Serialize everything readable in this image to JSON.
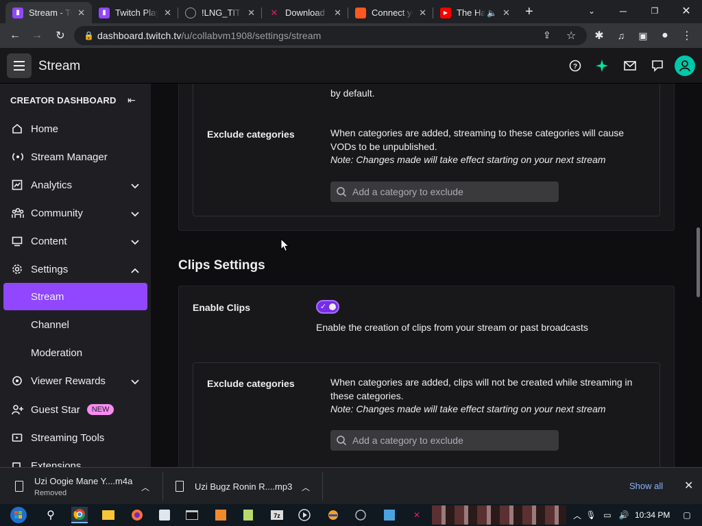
{
  "browser": {
    "tabs": [
      {
        "title": "Stream - Twitch",
        "active": true,
        "favicon": "twitch-icon",
        "color": "#9147ff"
      },
      {
        "title": "Twitch Plays",
        "active": false,
        "favicon": "twitch-icon",
        "color": "#9147ff"
      },
      {
        "title": "!LNG_TITLE",
        "active": false,
        "favicon": "globe-icon",
        "color": "#9aa0a6"
      },
      {
        "title": "Download",
        "active": false,
        "favicon": "download-site-icon",
        "color": "#e91e63"
      },
      {
        "title": "Connect yo",
        "active": false,
        "favicon": "orange-square-icon",
        "color": "#ff5722"
      },
      {
        "title": "The Ha",
        "active": false,
        "favicon": "youtube-icon",
        "color": "#ff0000"
      }
    ],
    "url_host": "dashboard.twitch.tv",
    "url_path": "/u/collabvm1908/settings/stream"
  },
  "topnav": {
    "title": "Stream"
  },
  "sidebar": {
    "header": "CREATOR DASHBOARD",
    "items": [
      {
        "label": "Home",
        "icon": "home-icon"
      },
      {
        "label": "Stream Manager",
        "icon": "broadcast-icon"
      },
      {
        "label": "Analytics",
        "icon": "analytics-icon"
      },
      {
        "label": "Community",
        "icon": "community-icon"
      },
      {
        "label": "Content",
        "icon": "content-icon"
      },
      {
        "label": "Settings",
        "icon": "settings-icon"
      },
      {
        "label": "Stream"
      },
      {
        "label": "Channel"
      },
      {
        "label": "Moderation"
      },
      {
        "label": "Viewer Rewards",
        "icon": "rewards-icon"
      },
      {
        "label": "Guest Star",
        "icon": "guest-star-icon",
        "badge": "NEW"
      },
      {
        "label": "Streaming Tools",
        "icon": "tools-icon"
      },
      {
        "label": "Extensions",
        "icon": "extensions-icon"
      }
    ]
  },
  "vods": {
    "default_text": "by default.",
    "exclude_label": "Exclude categories",
    "exclude_desc": "When categories are added, streaming to these categories will cause VODs to be unpublished.",
    "note": "Note: Changes made will take effect starting on your next stream",
    "search_placeholder": "Add a category to exclude"
  },
  "clips": {
    "title": "Clips Settings",
    "enable_label": "Enable Clips",
    "enabled": true,
    "enable_desc": "Enable the creation of clips from your stream or past broadcasts",
    "exclude_label": "Exclude categories",
    "exclude_desc": "When categories are added, clips will not be created while streaming in these categories.",
    "note": "Note: Changes made will take effect starting on your next stream",
    "search_placeholder": "Add a category to exclude"
  },
  "downloads": {
    "items": [
      {
        "name": "Uzi Oogie Mane Y....m4a",
        "status": "Removed"
      },
      {
        "name": "Uzi Bugz Ronin R....mp3",
        "status": ""
      }
    ],
    "show_all": "Show all"
  },
  "taskbar": {
    "time": "10:34 PM"
  }
}
